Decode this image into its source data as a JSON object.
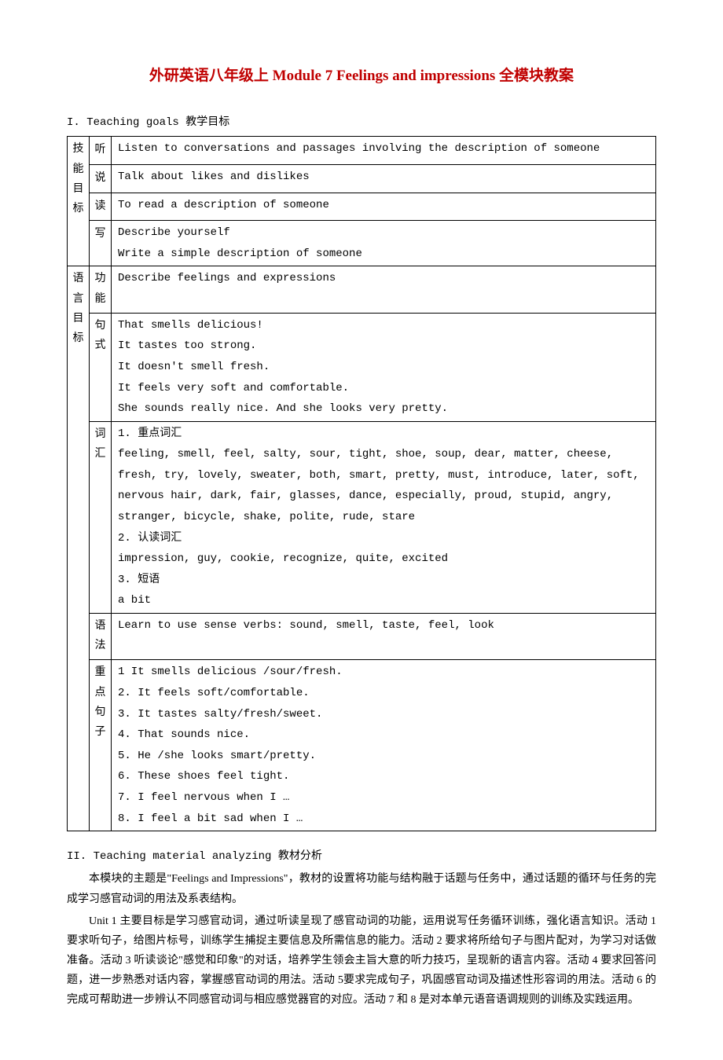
{
  "title": "外研英语八年级上 Module 7 Feelings and impressions 全模块教案",
  "section1": {
    "label": "I. Teaching goals 教学目标",
    "categories": [
      {
        "name": "技能目标",
        "rows": [
          {
            "sub": "听",
            "content": "Listen to conversations and passages involving the description of someone"
          },
          {
            "sub": "说",
            "content": "Talk about likes and dislikes"
          },
          {
            "sub": "读",
            "content": "To read a description of someone"
          },
          {
            "sub": "写",
            "content": "Describe yourself\nWrite a simple description of someone"
          }
        ]
      },
      {
        "name": "语言目标",
        "rows": [
          {
            "sub": "功能",
            "content": "Describe feelings and expressions"
          },
          {
            "sub": "句式",
            "content": "That smells delicious!\nIt tastes too strong.\nIt doesn't smell fresh.\nIt feels very soft and comfortable.\nShe sounds really nice. And she looks very pretty."
          },
          {
            "sub": "词汇",
            "content": "1. 重点词汇\n  feeling, smell, feel, salty, sour, tight, shoe, soup, dear, matter, cheese, fresh,  try, lovely, sweater, both, smart, pretty, must, introduce, later, soft, nervous  hair, dark, fair, glasses, dance, especially, proud, stupid, angry, stranger, bicycle, shake, polite, rude, stare\n2. 认读词汇\n   impression, guy, cookie, recognize, quite, excited\n3. 短语\n  a bit"
          },
          {
            "sub": "语法",
            "content": "Learn to use sense verbs: sound, smell, taste, feel, look"
          },
          {
            "sub": "重点句子",
            "content": "1 It smells delicious /sour/fresh.\n2. It feels soft/comfortable.\n3. It tastes salty/fresh/sweet.\n4. That sounds nice.\n5. He /she looks smart/pretty.\n6. These shoes feel tight.\n7. I feel nervous when I …\n8. I feel a bit sad when I …"
          }
        ]
      }
    ]
  },
  "section2": {
    "label": "II. Teaching material analyzing 教材分析",
    "para1": "本模块的主题是\"Feelings and Impressions\"，教材的设置将功能与结构融于话题与任务中，通过话题的循环与任务的完成学习感官动词的用法及系表结构。",
    "para2": "Unit 1 主要目标是学习感官动词，通过听读呈现了感官动词的功能，运用说写任务循环训练，强化语言知识。活动 1 要求听句子，给图片标号，训练学生捕捉主要信息及所需信息的能力。活动 2 要求将所给句子与图片配对，为学习对话做准备。活动 3 听读谈论\"感觉和印象\"的对话，培养学生领会主旨大意的听力技巧，呈现新的语言内容。活动 4 要求回答问题，进一步熟悉对话内容，掌握感官动词的用法。活动 5要求完成句子，巩固感官动词及描述性形容词的用法。活动 6 的完成可帮助进一步辨认不同感官动词与相应感觉器官的对应。活动 7 和 8 是对本单元语音语调规则的训练及实践运用。"
  }
}
